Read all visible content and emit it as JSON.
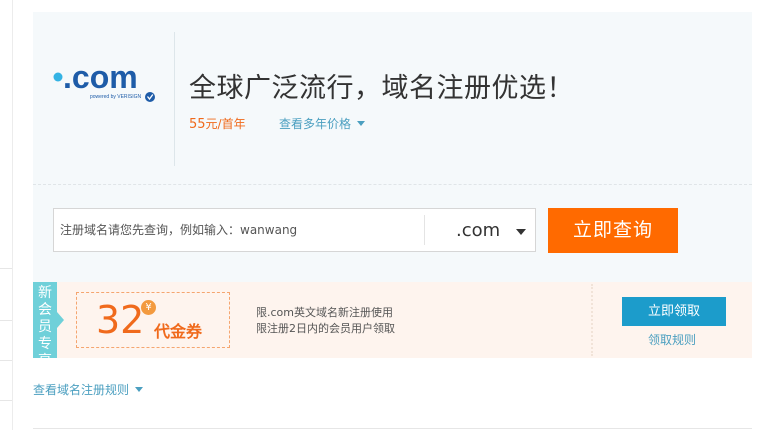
{
  "logo": {
    "text": ".com",
    "powered_by": "powered by VERISIGN",
    "accent": "#1e5ca8",
    "dot_color": "#34b3e4"
  },
  "header": {
    "headline": "全球广泛流行，域名注册优选！",
    "price_number": "55",
    "price_unit": "元/首年",
    "view_years_label": "查看多年价格"
  },
  "search": {
    "placeholder": "注册域名请您先查询，例如输入：wanwang",
    "tld_selected": ".com",
    "button_label": "立即查询"
  },
  "promo": {
    "tag_label": "新会员专享",
    "voucher_amount": "32",
    "currency_symbol": "¥",
    "voucher_label": "代金券",
    "desc_line1": "限.com英文域名新注册使用",
    "desc_line2": "限注册2日内的会员用户领取",
    "claim_button": "立即领取",
    "claim_rules": "领取规则"
  },
  "footer": {
    "rules_link": "查看域名注册规则"
  },
  "colors": {
    "primary_orange": "#ff6a00",
    "claim_blue": "#1c9ccb",
    "tag_teal": "#6fd0d9",
    "link_blue": "#4b9fc0"
  }
}
